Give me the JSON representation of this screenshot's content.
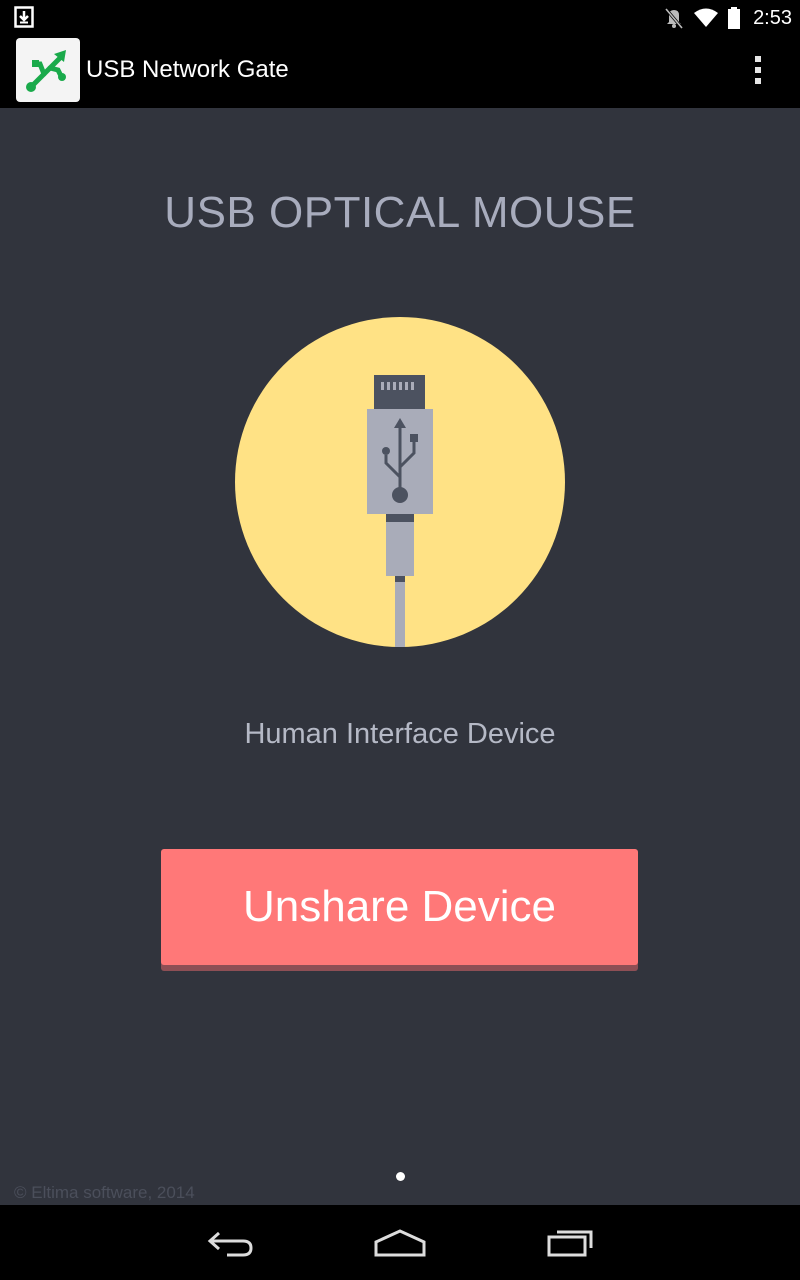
{
  "status_bar": {
    "time": "2:53",
    "icons": [
      "download-notification-icon",
      "mute-icon",
      "wifi-icon",
      "battery-icon"
    ]
  },
  "action_bar": {
    "app_icon": "usb-app-icon",
    "title": "USB Network Gate",
    "menu_icon": "overflow-menu-icon"
  },
  "device": {
    "name": "USB OPTICAL MOUSE",
    "class": "Human Interface Device",
    "illustration": "usb-plug-icon"
  },
  "unshare_button": {
    "label": "Unshare Device"
  },
  "pager": {
    "pages": 1,
    "current": 1
  },
  "footer": {
    "copyright": "© Eltima software, 2014"
  },
  "nav_bar": {
    "icons": [
      "back-icon",
      "home-icon",
      "recents-icon"
    ]
  },
  "colors": {
    "background": "#31343d",
    "title_text": "#a8acbd",
    "circle": "#ffe285",
    "button": "#ff7878",
    "button_shadow": "#8e4f55",
    "app_icon_green": "#1aaa4b"
  }
}
